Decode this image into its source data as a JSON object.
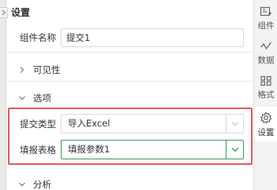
{
  "panel": {
    "title": "设置"
  },
  "component_name": {
    "label": "组件名称",
    "value": "提交1"
  },
  "sections": {
    "visibility": "可见性",
    "options": "选项",
    "analysis": "分析"
  },
  "options": {
    "submit_type_label": "提交类型",
    "submit_type_value": "导入Excel",
    "fill_form_label": "填报表格",
    "fill_form_value": "填报参数1"
  },
  "right_tabs": [
    {
      "label": "组件",
      "icon": "component-icon"
    },
    {
      "label": "数据",
      "icon": "data-icon"
    },
    {
      "label": "格式",
      "icon": "format-icon"
    },
    {
      "label": "设置",
      "icon": "settings-icon"
    }
  ],
  "colors": {
    "accent_green": "#3d9b5a",
    "highlight_red": "#e3565b"
  }
}
